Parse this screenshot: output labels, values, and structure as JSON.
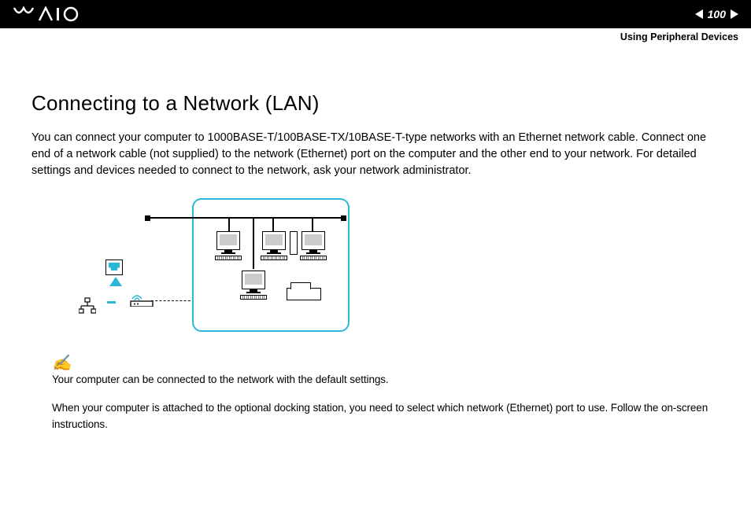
{
  "header": {
    "page_number": "100",
    "section": "Using Peripheral Devices"
  },
  "content": {
    "title": "Connecting to a Network (LAN)",
    "body": "You can connect your computer to 1000BASE-T/100BASE-TX/10BASE-T-type networks with an Ethernet network cable. Connect one end of a network cable (not supplied) to the network (Ethernet) port on the computer and the other end to your network. For detailed settings and devices needed to connect to the network, ask your network administrator.",
    "note1": "Your computer can be connected to the network with the default settings.",
    "note2": "When your computer is attached to the optional docking station, you need to select which network (Ethernet) port to use. Follow the on-screen instructions."
  }
}
